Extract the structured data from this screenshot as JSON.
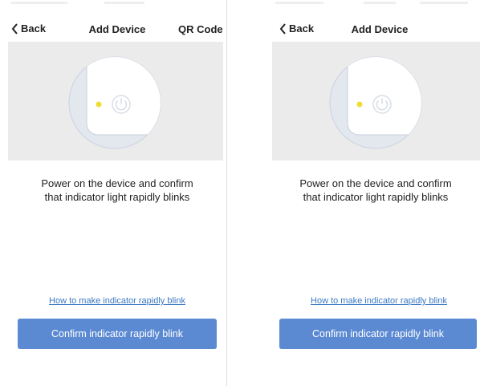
{
  "colors": {
    "hero_background": "#ebebeb",
    "button_background": "#5b8ad3",
    "link_color": "#3b78c4",
    "indicator_light": "#f1dc34",
    "text": "#222222"
  },
  "screens": [
    {
      "nav": {
        "back_icon": "chevron-left-icon",
        "back_label": "Back",
        "title": "Add Device",
        "right_action": "QR Code"
      },
      "illustration": {
        "icons": [
          "indicator-light-icon",
          "power-icon"
        ]
      },
      "instruction_line1": "Power on the device and confirm",
      "instruction_line2": "that indicator light rapidly blinks",
      "help_link": "How to make indicator rapidly blink",
      "confirm_button": "Confirm indicator rapidly blink"
    },
    {
      "nav": {
        "back_icon": "chevron-left-icon",
        "back_label": "Back",
        "title": "Add Device"
      },
      "illustration": {
        "icons": [
          "indicator-light-icon",
          "power-icon"
        ]
      },
      "instruction_line1": "Power on the device and confirm",
      "instruction_line2": "that indicator light rapidly blinks",
      "help_link": "How to make indicator rapidly blink",
      "confirm_button": "Confirm indicator rapidly blink"
    }
  ]
}
